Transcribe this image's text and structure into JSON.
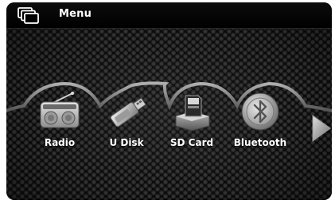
{
  "header": {
    "title": "Menu",
    "icon": "windows-icon"
  },
  "menu": {
    "items": [
      {
        "label": "Radio",
        "icon": "radio-icon"
      },
      {
        "label": "U Disk",
        "icon": "usb-drive-icon"
      },
      {
        "label": "SD Card",
        "icon": "sd-card-icon"
      },
      {
        "label": "Bluetooth",
        "icon": "bluetooth-icon"
      }
    ],
    "next_icon": "next-arrow-icon"
  },
  "colors": {
    "background": "#0b0b0b",
    "text": "#ffffff",
    "arch": "#8a8a8a"
  }
}
